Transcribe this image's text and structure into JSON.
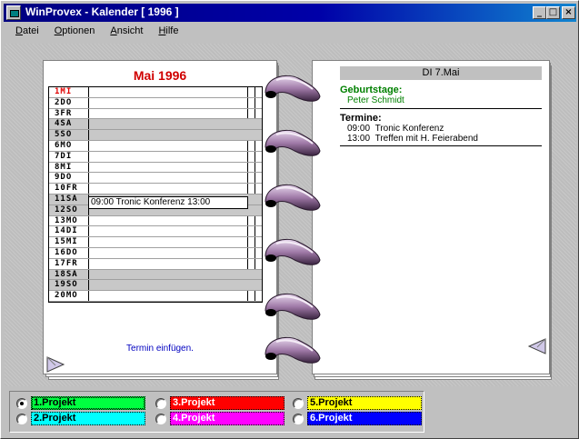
{
  "window": {
    "title": "WinProvex - Kalender [ 1996 ]"
  },
  "titlebar_buttons": {
    "minimize": "_",
    "maximize": "□",
    "close": "×"
  },
  "menu": [
    "Datei",
    "Optionen",
    "Ansicht",
    "Hilfe"
  ],
  "left_page": {
    "month_title": "Mai 1996",
    "days": [
      {
        "label": "1MI",
        "weekend": false,
        "highlight": true
      },
      {
        "label": "2DO",
        "weekend": false,
        "highlight": false
      },
      {
        "label": "3FR",
        "weekend": false,
        "highlight": false
      },
      {
        "label": "4SA",
        "weekend": true,
        "highlight": false
      },
      {
        "label": "5SO",
        "weekend": true,
        "highlight": false
      },
      {
        "label": "6MO",
        "weekend": false,
        "highlight": false
      },
      {
        "label": "7DI",
        "weekend": false,
        "highlight": false
      },
      {
        "label": "8MI",
        "weekend": false,
        "highlight": false
      },
      {
        "label": "9DO",
        "weekend": false,
        "highlight": false
      },
      {
        "label": "10FR",
        "weekend": false,
        "highlight": false
      },
      {
        "label": "11SA",
        "weekend": true,
        "highlight": false
      },
      {
        "label": "12SO",
        "weekend": true,
        "highlight": false
      },
      {
        "label": "13MO",
        "weekend": false,
        "highlight": false
      },
      {
        "label": "14DI",
        "weekend": false,
        "highlight": false
      },
      {
        "label": "15MI",
        "weekend": false,
        "highlight": false
      },
      {
        "label": "16DO",
        "weekend": false,
        "highlight": false
      },
      {
        "label": "17FR",
        "weekend": false,
        "highlight": false
      },
      {
        "label": "18SA",
        "weekend": true,
        "highlight": false
      },
      {
        "label": "19SO",
        "weekend": true,
        "highlight": false
      },
      {
        "label": "20MO",
        "weekend": false,
        "highlight": false
      }
    ],
    "selected_day_entry": "09:00 Tronic Konferenz  13:00",
    "insert_link": "Termin einfügen."
  },
  "right_page": {
    "date_header": "DI 7.Mai",
    "birthdays_title": "Geburtstage:",
    "birthdays": [
      "Peter Schmidt"
    ],
    "appointments_title": "Termine:",
    "appointments": [
      {
        "time": "09:00",
        "text": "Tronic Konferenz"
      },
      {
        "time": "13:00",
        "text": "Treffen mit H. Feierabend"
      }
    ]
  },
  "projects": [
    {
      "label": "1.Projekt",
      "color": "#00ff40",
      "text_color": "#000000",
      "selected": true
    },
    {
      "label": "2.Projekt",
      "color": "#00ffff",
      "text_color": "#000000",
      "selected": false
    },
    {
      "label": "3.Projekt",
      "color": "#ff0000",
      "text_color": "#ffffff",
      "selected": false
    },
    {
      "label": "4.Projekt",
      "color": "#ff00ff",
      "text_color": "#ffffff",
      "selected": false
    },
    {
      "label": "5.Projekt",
      "color": "#ffff00",
      "text_color": "#000000",
      "selected": false
    },
    {
      "label": "6.Projekt",
      "color": "#0000ff",
      "text_color": "#ffffff",
      "selected": false
    }
  ],
  "colors": {
    "title_bar": "#000080",
    "month_title": "#d00000",
    "birthday_text": "#008000",
    "link": "#0000c0"
  }
}
